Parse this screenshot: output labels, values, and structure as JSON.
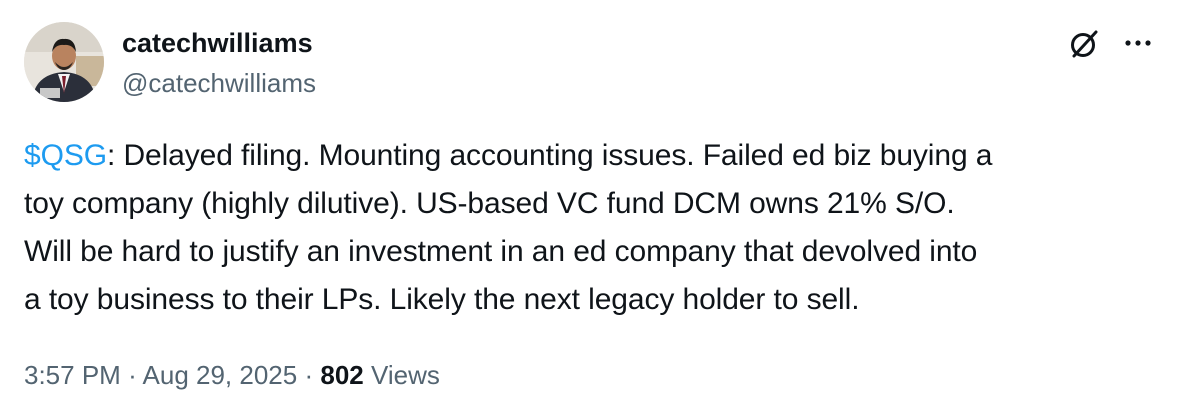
{
  "author": {
    "display_name": "catechwilliams",
    "handle": "@catechwilliams"
  },
  "tweet": {
    "cashtag": "$QSG",
    "line1_rest": ": Delayed filing. Mounting accounting issues. Failed ed biz buying a",
    "line2": "toy company (highly dilutive). US-based VC fund DCM owns 21% S/O.",
    "line3": "Will be hard to justify an investment in an ed company that devolved into",
    "line4": "a toy business to their LPs. Likely the next legacy holder to sell."
  },
  "meta": {
    "time": "3:57 PM",
    "separator": "·",
    "date": "Aug 29, 2025",
    "views_count": "802",
    "views_label": "Views"
  },
  "icons": {
    "grok": "grok-icon",
    "more": "more-icon"
  },
  "colors": {
    "link": "#1d9bf0",
    "secondary_text": "#536471",
    "primary_text": "#0f1419"
  }
}
